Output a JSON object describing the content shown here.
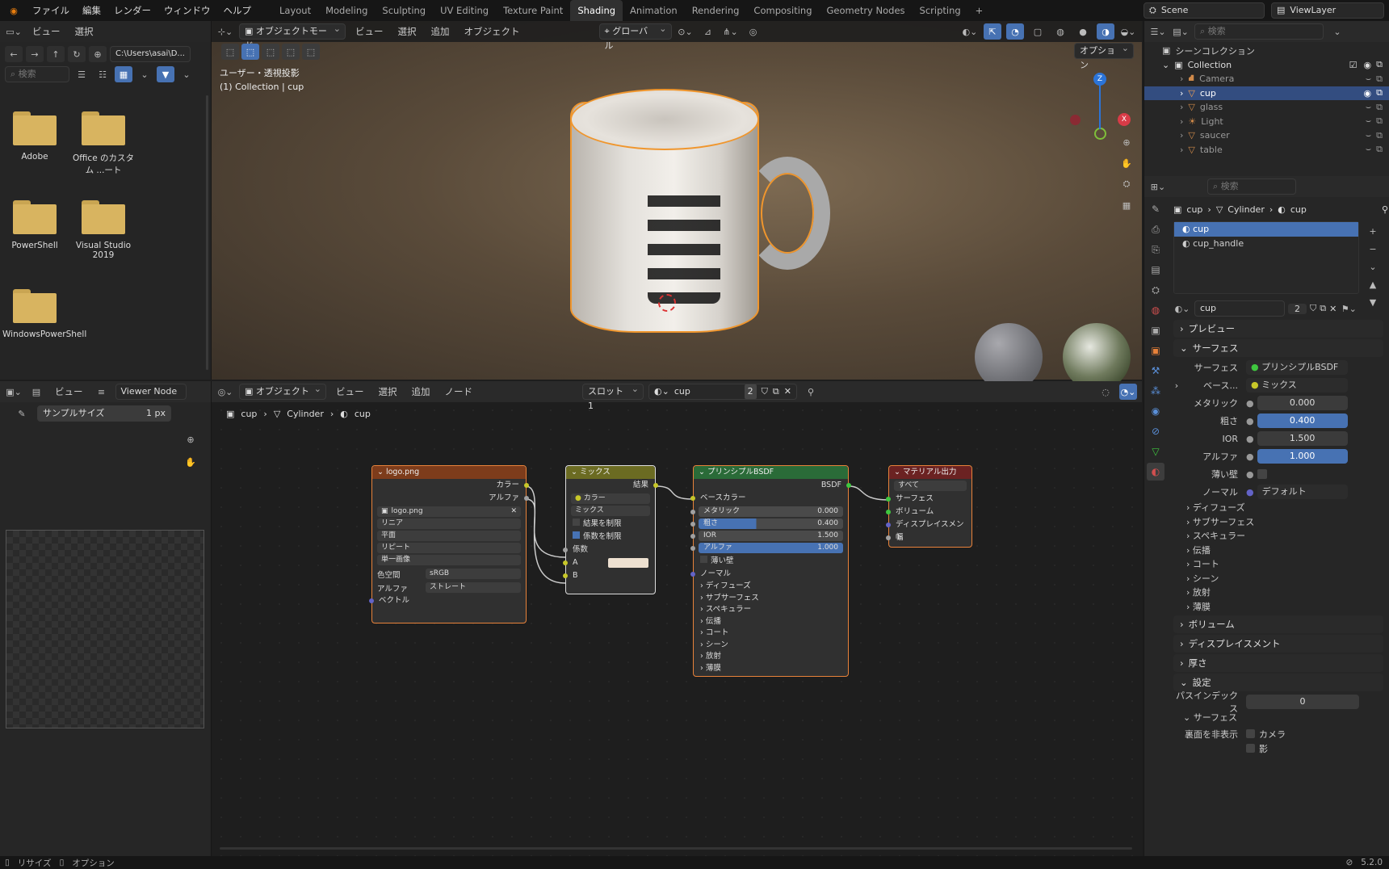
{
  "menus": [
    "ファイル",
    "編集",
    "レンダー",
    "ウィンドウ",
    "ヘルプ"
  ],
  "workspaces": [
    "Layout",
    "Modeling",
    "Sculpting",
    "UV Editing",
    "Texture Paint",
    "Shading",
    "Animation",
    "Rendering",
    "Compositing",
    "Geometry Nodes",
    "Scripting"
  ],
  "active_workspace": "Shading",
  "scene": "Scene",
  "view_layer": "ViewLayer",
  "file_browser": {
    "menus": [
      "ビュー",
      "選択"
    ],
    "path": "C:\\Users\\asai\\D...",
    "search_placeholder": "検索",
    "folders": [
      "Adobe",
      "Office のカスタム ...ート",
      "PowerShell",
      "Visual Studio 2019",
      "WindowsPowerShell"
    ]
  },
  "viewport": {
    "mode": "オブジェクトモード",
    "menus": [
      "ビュー",
      "選択",
      "追加",
      "オブジェクト"
    ],
    "transform": "グローバル",
    "options": "オプション",
    "info1": "ユーザー・透視投影",
    "info2": "(1) Collection | cup",
    "axis_x": "X",
    "axis_z": "Z"
  },
  "image_editor": {
    "menus": [
      "ビュー"
    ],
    "viewer": "Viewer Node",
    "sample_label": "サンプルサイズ",
    "sample_value": "1 px"
  },
  "node_editor": {
    "mode": "オブジェクト",
    "menus": [
      "ビュー",
      "選択",
      "追加",
      "ノード"
    ],
    "slot": "スロット1",
    "material": "cup",
    "users": "2",
    "breadcrumb": [
      "cup",
      "Cylinder",
      "cup"
    ]
  },
  "nodes": {
    "image": {
      "title": "logo.png",
      "out": [
        "カラー",
        "アルファ"
      ],
      "image": "logo.png",
      "interp": "リニア",
      "proj": "平面",
      "ext": "リピート",
      "source": "単一画像",
      "cs_label": "色空間",
      "cs": "sRGB",
      "alpha_label": "アルファ",
      "alpha": "ストレート",
      "vector": "ベクトル"
    },
    "mix": {
      "title": "ミックス",
      "out": "結果",
      "type": "カラー",
      "blend": "ミックス",
      "clamp_result": "結果を制限",
      "clamp_factor": "係数を制限",
      "factor": "係数",
      "a": "A",
      "b": "B",
      "b_color": "#ede0d0"
    },
    "bsdf": {
      "title": "プリンシプルBSDF",
      "out": "BSDF",
      "base": "ベースカラー",
      "metallic": "メタリック",
      "metallic_v": "0.000",
      "rough": "粗さ",
      "rough_v": "0.400",
      "ior": "IOR",
      "ior_v": "1.500",
      "alpha": "アルファ",
      "alpha_v": "1.000",
      "thin": "薄い壁",
      "normal": "ノーマル",
      "panels": [
        "ディフューズ",
        "サブサーフェス",
        "スペキュラー",
        "伝播",
        "コート",
        "シーン",
        "放射",
        "薄膜"
      ]
    },
    "output": {
      "title": "マテリアル出力",
      "target": "すべて",
      "inputs": [
        "サーフェス",
        "ボリューム",
        "ディスプレイスメント",
        "幅"
      ]
    }
  },
  "outliner": {
    "search_placeholder": "検索",
    "scene_collection": "シーンコレクション",
    "collection": "Collection",
    "items": [
      "Camera",
      "cup",
      "glass",
      "Light",
      "saucer",
      "table"
    ],
    "selected": "cup"
  },
  "properties": {
    "search_placeholder": "検索",
    "breadcrumb": [
      "cup",
      "Cylinder",
      "cup"
    ],
    "slots": [
      "cup",
      "cup_handle"
    ],
    "material": "cup",
    "users": "2",
    "preview": "プレビュー",
    "surface_sec": "サーフェス",
    "surface_label": "サーフェス",
    "surface_val": "プリンシプルBSDF",
    "base_label": "ベース...",
    "base_val": "ミックス",
    "metallic_label": "メタリック",
    "metallic": "0.000",
    "rough_label": "粗さ",
    "rough": "0.400",
    "ior_label": "IOR",
    "ior": "1.500",
    "alpha_label": "アルファ",
    "alpha": "1.000",
    "thin_label": "薄い壁",
    "normal_label": "ノーマル",
    "normal_val": "デフォルト",
    "sub_panels": [
      "ディフューズ",
      "サブサーフェス",
      "スペキュラー",
      "伝播",
      "コート",
      "シーン",
      "放射",
      "薄膜"
    ],
    "volume": "ボリューム",
    "displacement": "ディスプレイスメント",
    "thickness": "厚さ",
    "settings": "設定",
    "pass_label": "パスインデックス",
    "pass_val": "0",
    "surface2": "サーフェス",
    "backface_label": "裏面を非表示",
    "camera": "カメラ",
    "shadow": "影"
  },
  "status": {
    "left1": "リサイズ",
    "left2": "オプション",
    "version": "5.2.0"
  }
}
